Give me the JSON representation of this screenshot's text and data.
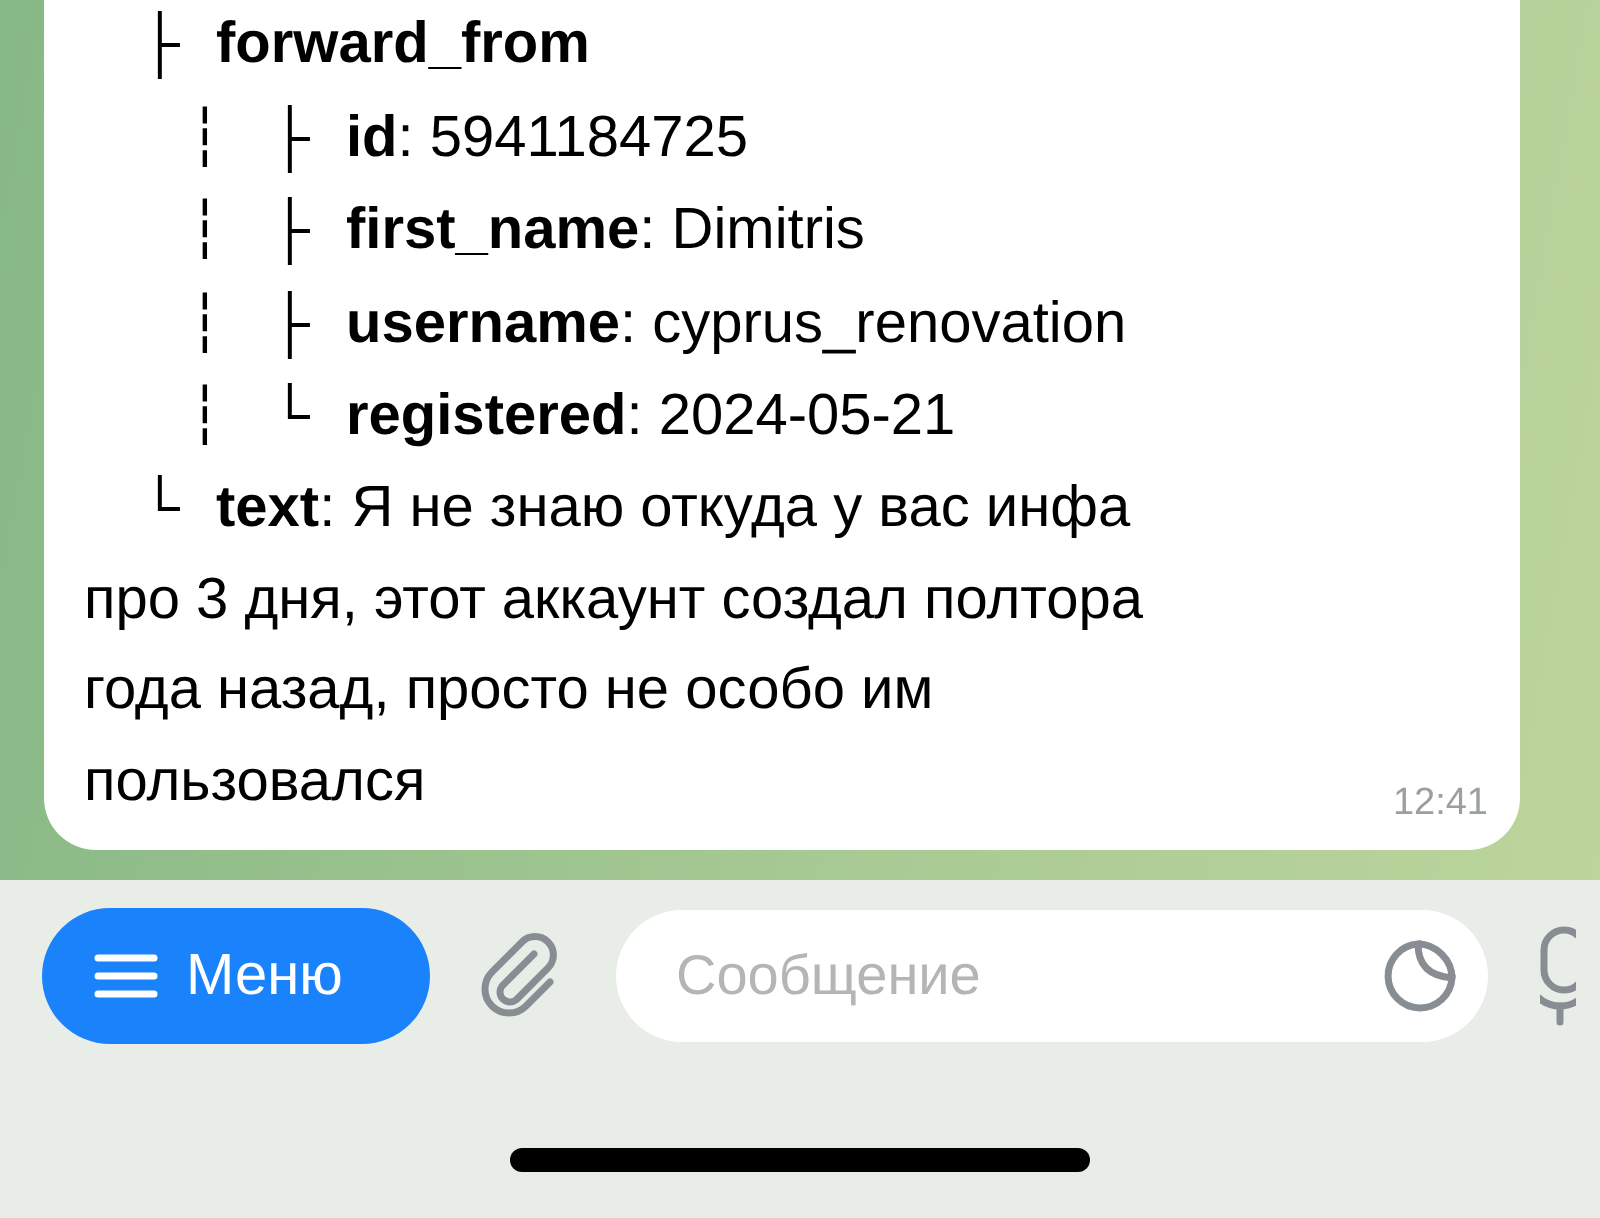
{
  "message": {
    "lines": [
      {
        "guides": [
          "├"
        ],
        "text": "**forward_from**"
      },
      {
        "guides": [
          "┆",
          "├"
        ],
        "text": "**id**: 5941184725"
      },
      {
        "guides": [
          "┆",
          "├"
        ],
        "text": "**first_name**: Dimitris"
      },
      {
        "guides": [
          "┆",
          "├"
        ],
        "text": "**username**: cyprus_renovation"
      },
      {
        "guides": [
          "┆",
          "└"
        ],
        "text": "**registered**: 2024-05-21"
      },
      {
        "guides": [
          "└"
        ],
        "text": "**text**: Я не знаю откуда у вас инфа про 3 дня, этот аккаунт создал полтора года назад, просто не особо им пользовался"
      }
    ],
    "time": "12:41"
  },
  "composer": {
    "menu_label": "Меню",
    "placeholder": "Сообщение"
  }
}
